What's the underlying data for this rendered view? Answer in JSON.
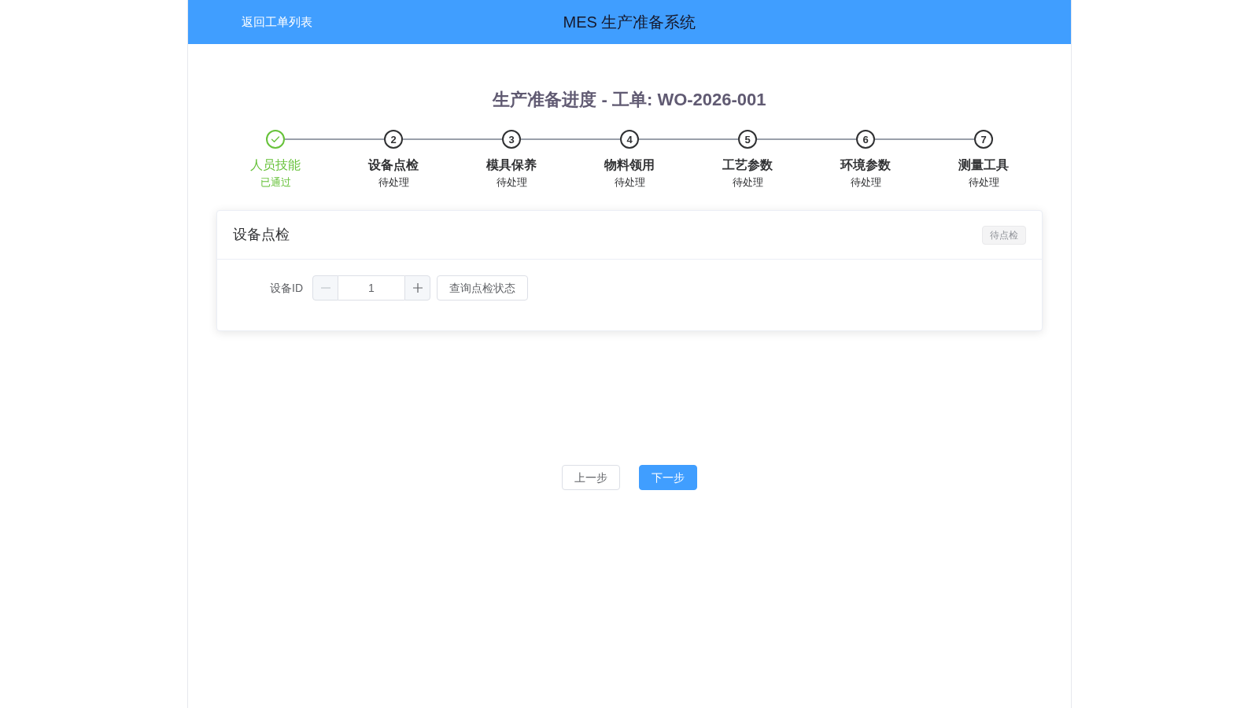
{
  "header": {
    "back_link": "返回工单列表",
    "title": "MES 生产准备系统"
  },
  "progress": {
    "title": "生产准备进度 - 工单: WO-2026-001",
    "steps": [
      {
        "label": "人员技能",
        "status": "已通过",
        "finished": true
      },
      {
        "number": "2",
        "label": "设备点检",
        "status": "待处理",
        "finished": false
      },
      {
        "number": "3",
        "label": "模具保养",
        "status": "待处理",
        "finished": false
      },
      {
        "number": "4",
        "label": "物料领用",
        "status": "待处理",
        "finished": false
      },
      {
        "number": "5",
        "label": "工艺参数",
        "status": "待处理",
        "finished": false
      },
      {
        "number": "6",
        "label": "环境参数",
        "status": "待处理",
        "finished": false
      },
      {
        "number": "7",
        "label": "测量工具",
        "status": "待处理",
        "finished": false
      }
    ]
  },
  "panel": {
    "title": "设备点检",
    "tag": "待点检",
    "field_label": "设备ID",
    "value": "1",
    "decrease_disabled": true,
    "query_button": "查询点检状态"
  },
  "footer_buttons": [
    {
      "label": "上一步",
      "kind": "default"
    },
    {
      "label": "下一步",
      "kind": "primary"
    }
  ]
}
